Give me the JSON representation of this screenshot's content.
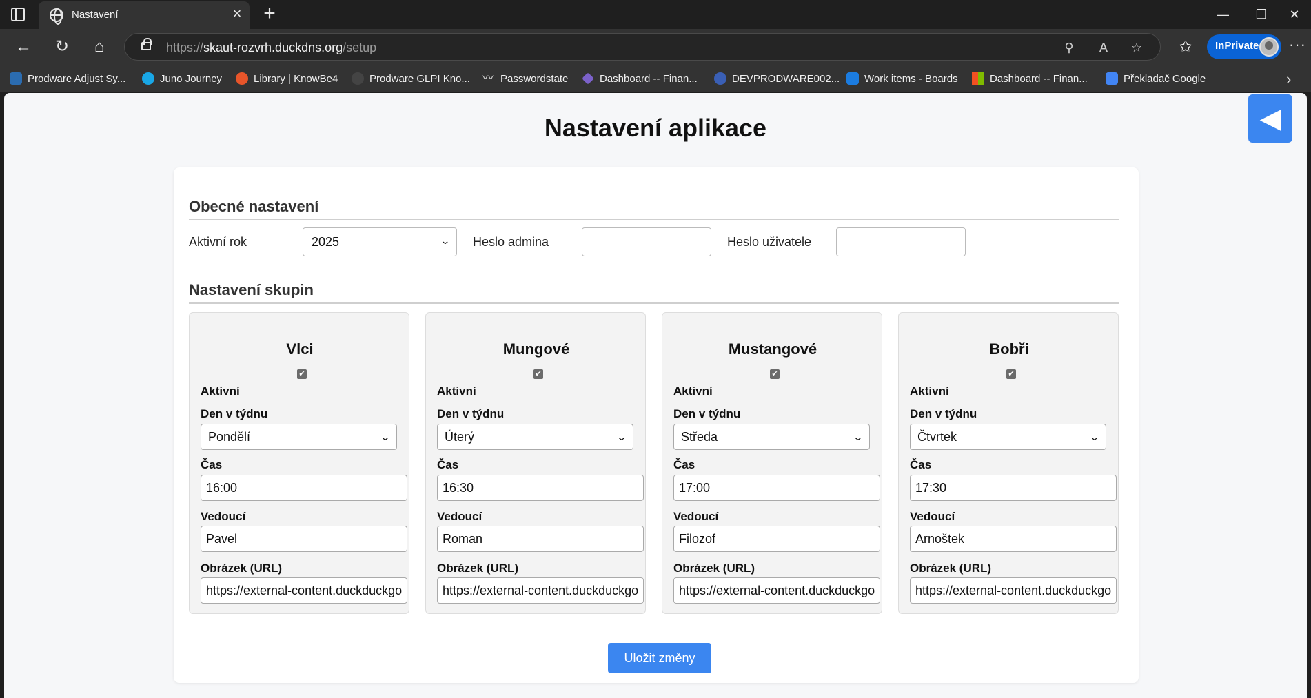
{
  "browser": {
    "tab_title": "Nastavení",
    "url_host": "skaut-rozvrh.duckdns.org",
    "url_path": "/setup",
    "url_scheme": "https://",
    "inprivate_label": "InPrivate",
    "bookmarks": [
      {
        "label": "Prodware Adjust Sy...",
        "color": "#2b6cb0"
      },
      {
        "label": "Juno Journey",
        "color": "#19a7e6"
      },
      {
        "label": "Library | KnowBe4",
        "color": "#e8552a"
      },
      {
        "label": "Prodware GLPI Kno...",
        "color": "#444444"
      },
      {
        "label": "Passwordstate",
        "color": "#333333"
      },
      {
        "label": "Dashboard -- Finan...",
        "color": "#7b61c9"
      },
      {
        "label": "DEVPRODWARE002...",
        "color": "#3a5fb5"
      },
      {
        "label": "Work items - Boards",
        "color": "#1b7ce0"
      },
      {
        "label": "Dashboard -- Finan...",
        "color": "#f25022"
      },
      {
        "label": "Překladač Google",
        "color": "#4285f4"
      }
    ]
  },
  "page": {
    "title": "Nastavení aplikace",
    "back_symbol": "◀",
    "general": {
      "heading": "Obecné nastavení",
      "year_label": "Aktivní rok",
      "year_value": "2025",
      "admin_password_label": "Heslo admina",
      "admin_password_value": "",
      "user_password_label": "Heslo uživatele",
      "user_password_value": ""
    },
    "groups_heading": "Nastavení skupin",
    "labels": {
      "active": "Aktivní",
      "weekday": "Den v týdnu",
      "time": "Čas",
      "leader": "Vedoucí",
      "image": "Obrázek (URL)"
    },
    "groups": [
      {
        "name": "Vlci",
        "active": true,
        "weekday": "Pondělí",
        "time": "16:00",
        "leader": "Pavel",
        "image_url": "https://external-content.duckduckgo"
      },
      {
        "name": "Mungové",
        "active": true,
        "weekday": "Úterý",
        "time": "16:30",
        "leader": "Roman",
        "image_url": "https://external-content.duckduckgo"
      },
      {
        "name": "Mustangové",
        "active": true,
        "weekday": "Středa",
        "time": "17:00",
        "leader": "Filozof",
        "image_url": "https://external-content.duckduckgo"
      },
      {
        "name": "Bobři",
        "active": true,
        "weekday": "Čtvrtek",
        "time": "17:30",
        "leader": "Arnoštek",
        "image_url": "https://external-content.duckduckgo"
      }
    ],
    "save_label": "Uložit změny"
  },
  "colors": {
    "accent": "#3b86f0",
    "page_bg": "#f6f7f9",
    "chrome_bg": "#333333"
  }
}
